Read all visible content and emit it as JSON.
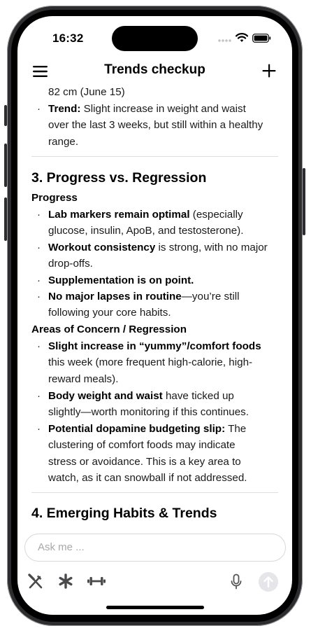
{
  "status_bar": {
    "time": "16:32"
  },
  "header": {
    "title": "Trends checkup"
  },
  "content": {
    "top_continuation": "82 cm (June 15)",
    "trend_bullet": {
      "label": "Trend:",
      "text_line1": " Slight increase in weight and waist",
      "text_line2": "over the last 3 weeks, but still within a healthy",
      "text_line3": "range."
    },
    "section3": {
      "heading": "3. Progress vs. Regression",
      "progress_heading": "Progress",
      "progress_items": [
        {
          "bold": "Lab markers remain optimal",
          "rest_line1": " (especially",
          "rest_line2": "glucose, insulin, ApoB, and testosterone)."
        },
        {
          "bold": "Workout consistency",
          "rest_line1": " is strong, with no major",
          "rest_line2": "drop-offs."
        },
        {
          "bold": "Supplementation is on point.",
          "rest_line1": "",
          "rest_line2": ""
        },
        {
          "bold": "No major lapses in routine",
          "rest_line1": "—you’re still",
          "rest_line2": "following your core habits."
        }
      ],
      "concern_heading": "Areas of Concern / Regression",
      "concern_items": [
        {
          "bold": "Slight increase in “yummy”/comfort foods",
          "line2": "this week (more frequent high-calorie, high-",
          "line3": "reward meals)."
        },
        {
          "bold": "Body weight and waist",
          "rest_line1": " have ticked up",
          "line2": "slightly—worth monitoring if this continues."
        },
        {
          "bold": "Potential dopamine budgeting slip:",
          "rest_line1": " The",
          "line2": "clustering of comfort foods may indicate",
          "line3": "stress or avoidance. This is a key area to",
          "line4": "watch, as it can snowball if not addressed."
        }
      ]
    },
    "section4": {
      "heading": "4. Emerging Habits & Trends"
    }
  },
  "composer": {
    "placeholder": "Ask me ..."
  },
  "toolbar": {
    "icons": [
      "fork-knife-icon",
      "asterisk-icon",
      "dumbbell-icon",
      "microphone-icon",
      "arrow-up-icon"
    ]
  },
  "colors": {
    "text": "#1a1a1a",
    "divider": "#dedede",
    "send_button_bg": "#e5e5ea",
    "icon_gray": "#555555"
  }
}
